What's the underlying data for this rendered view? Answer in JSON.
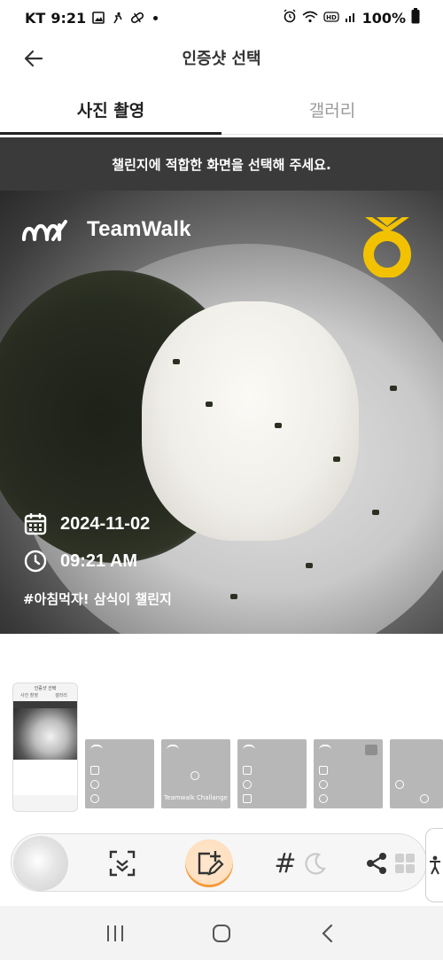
{
  "status_bar": {
    "carrier": "KT",
    "time": "9:21",
    "battery": "100%",
    "icons": [
      "image-icon",
      "accessibility-icon",
      "pill-icon",
      "alarm-icon",
      "wifi-icon",
      "hd-icon",
      "signal-icon",
      "battery-icon"
    ]
  },
  "header": {
    "title": "인증샷 선택",
    "back_icon": "arrow-left-icon"
  },
  "tabs": [
    {
      "label": "사진 촬영",
      "active": true
    },
    {
      "label": "갤러리",
      "active": false
    }
  ],
  "banner": {
    "text": "챌린지에 적합한 화면을 선택해 주세요."
  },
  "photo": {
    "brand_name": "TeamWalk",
    "date": "2024-11-02",
    "time": "09:21 AM",
    "hashtag": "#아침먹자! 삼식이 챌린지",
    "accent_color": "#f2c200"
  },
  "thumbnails": {
    "selected_index": 0,
    "items": [
      {
        "type": "screenshot"
      },
      {
        "type": "template-date-time-chat"
      },
      {
        "type": "template-challenge",
        "caption": "Teamwalk Challange"
      },
      {
        "type": "template-date-time-walk"
      },
      {
        "type": "template-date-time-chat-logo"
      },
      {
        "type": "template-time-chat"
      }
    ]
  },
  "toolbar": {
    "buttons": [
      {
        "icon": "scan-icon"
      },
      {
        "icon": "add-sticker-edit-icon",
        "active": true
      },
      {
        "icon": "hashtag-icon",
        "label": "#"
      },
      {
        "icon": "moon-icon"
      },
      {
        "icon": "share-icon"
      },
      {
        "icon": "grid-icon"
      }
    ],
    "active_color": "#f39a3c",
    "side_icon": "accessibility-person-icon"
  },
  "nav_bar": {
    "buttons": [
      "recent-apps-icon",
      "home-icon",
      "back-icon"
    ]
  }
}
